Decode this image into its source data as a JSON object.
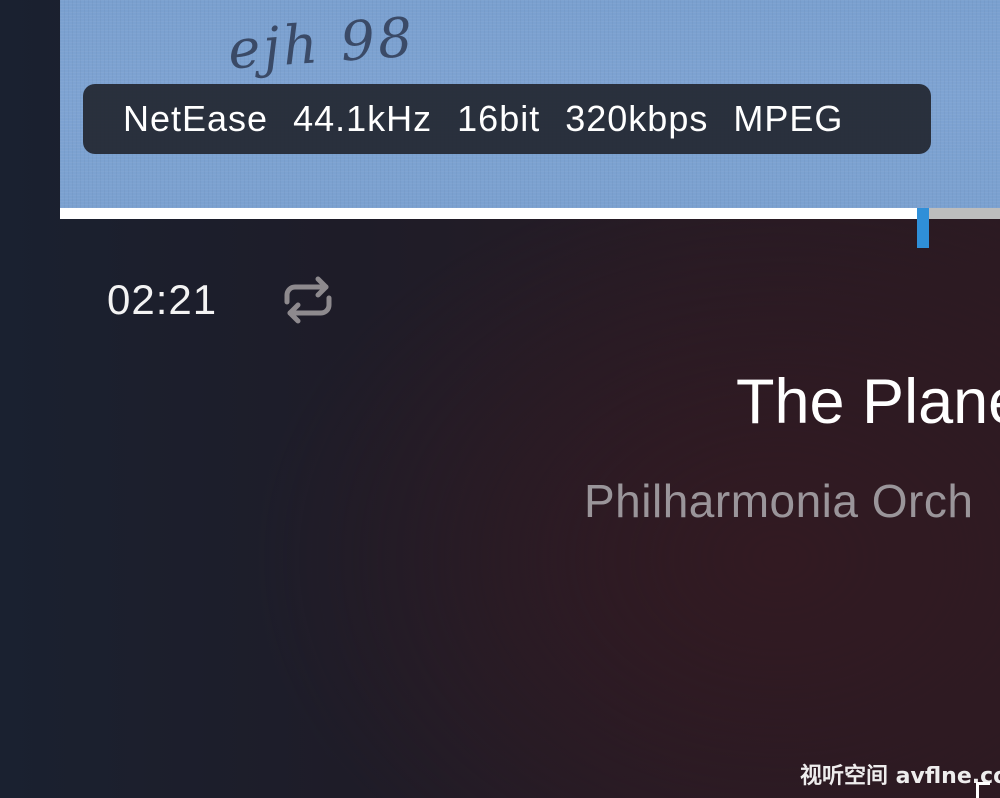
{
  "album_art": {
    "handwritten_signature": "ejh 98"
  },
  "format_badge": {
    "source": "NetEase",
    "sample_rate": "44.1kHz",
    "bit_depth": "16bit",
    "bitrate": "320kbps",
    "codec": "MPEG"
  },
  "playback": {
    "elapsed": "02:21",
    "progress_fraction": 0.918,
    "repeat_icon": "repeat-icon"
  },
  "track": {
    "title": "The Plane",
    "artist": "Philharmonia Orch"
  },
  "watermark": {
    "text": "视听空间 avflne.com"
  },
  "colors": {
    "progress_thumb": "#2f8fd8",
    "progress_fill": "#ffffff",
    "progress_track": "#bdbdbd",
    "album_art_blue": "#7ea3d2"
  }
}
